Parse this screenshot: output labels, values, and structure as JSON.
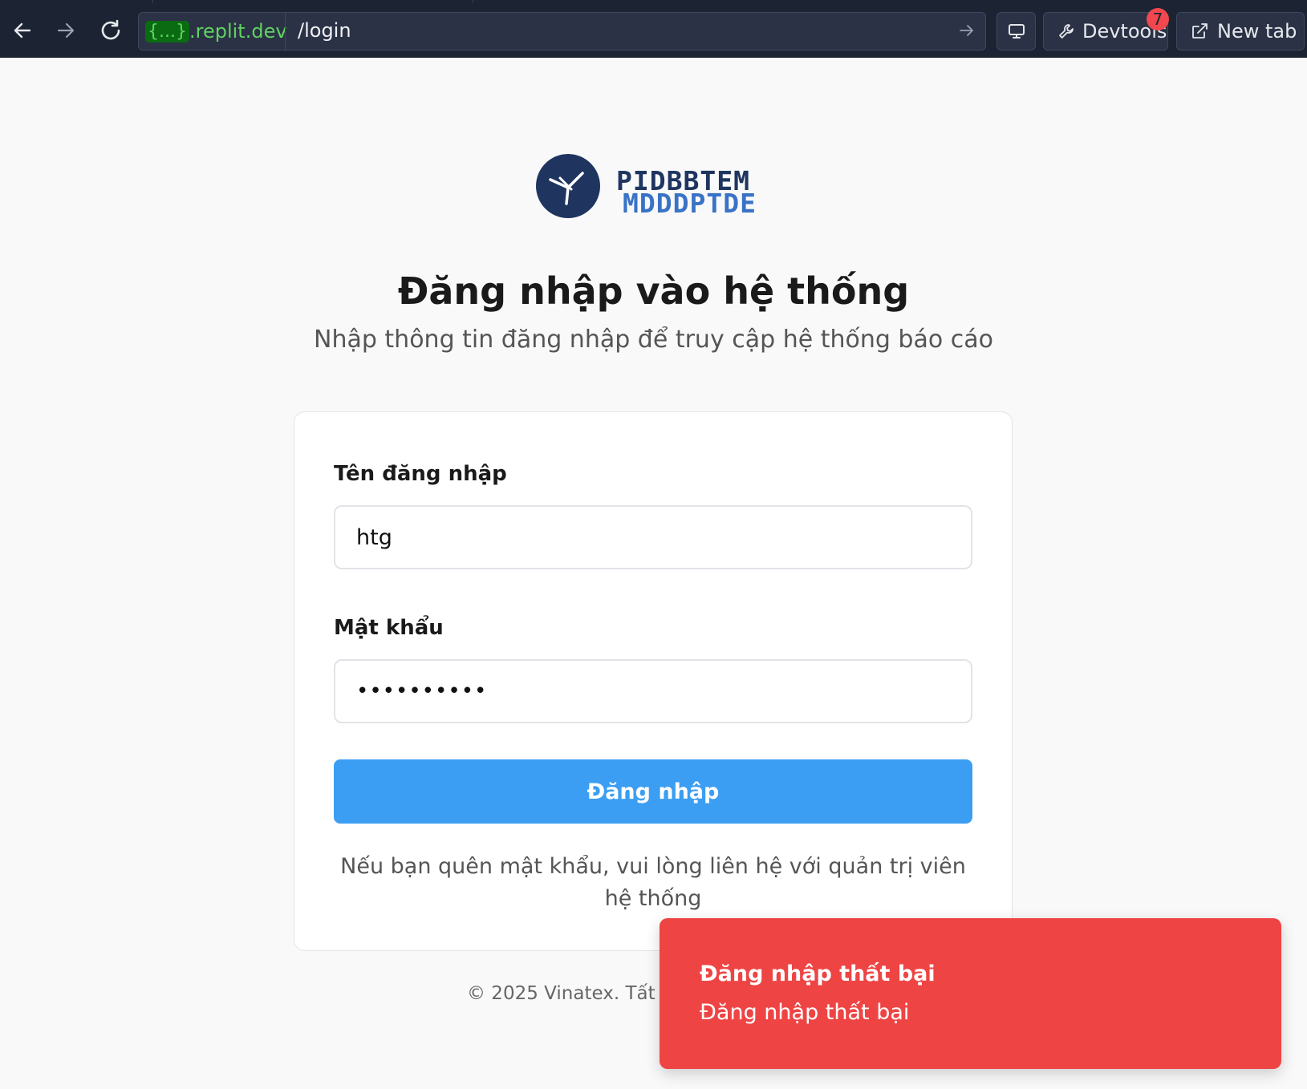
{
  "browser": {
    "url_host_brace": "{...}",
    "url_host": ".replit.dev",
    "url_path": "/login",
    "devtools_label": "Devtools",
    "devtools_badge": "7",
    "new_tab_label": "New tab"
  },
  "logo": {
    "line1": "PIDBBTEM",
    "line2": "MDDDPTDE"
  },
  "page": {
    "title": "Đăng nhập vào hệ thống",
    "subtitle": "Nhập thông tin đăng nhập để truy cập hệ thống báo cáo"
  },
  "form": {
    "username_label": "Tên đăng nhập",
    "username_value": "htg",
    "password_label": "Mật khẩu",
    "password_value": "••••••••••",
    "submit_label": "Đăng nhập",
    "hint": "Nếu bạn quên mật khẩu, vui lòng liên hệ với quản trị viên hệ thống"
  },
  "footer": {
    "text": "© 2025 Vinatex. Tất cả"
  },
  "toast": {
    "title": "Đăng nhập thất bại",
    "description": "Đăng nhập thất bại",
    "color": "#ef4444"
  }
}
